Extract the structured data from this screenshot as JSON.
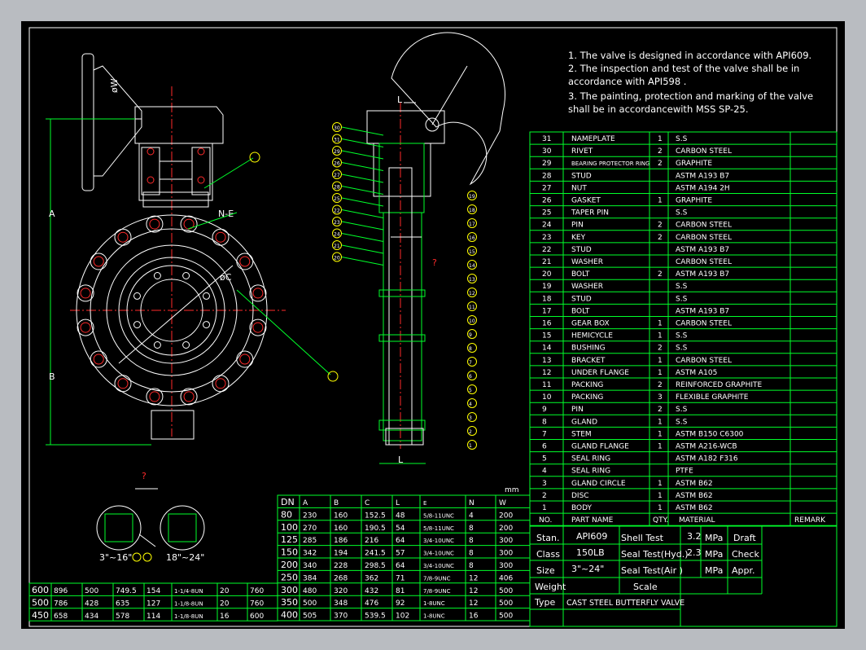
{
  "notes": [
    "1.  The valve is designed in accordance with API609.",
    "2.  The inspection and test of the valve shall be in",
    "     accordance with API598 .",
    "3.  The painting, protection and marking of the valve",
    "     shall be in accordancewith MSS SP-25."
  ],
  "labels": {
    "dim_A": "A",
    "dim_B": "B",
    "dim_L": "L",
    "dim_phiW": "øW",
    "dim_ne": "N-E",
    "dim_phiC": "øC",
    "question_a": "?",
    "question_b": "?",
    "detail_left": "3\"~16\"",
    "detail_right": "18\"~24\"",
    "unit_mm": "mm"
  },
  "parts_table": {
    "rows": [
      [
        "31",
        "NAMEPLATE",
        "1",
        "S.S"
      ],
      [
        "30",
        "RIVET",
        "2",
        "CARBON STEEL"
      ],
      [
        "29",
        "BEARING PROTECTOR RING",
        "2",
        "GRAPHITE"
      ],
      [
        "28",
        "STUD",
        "",
        "ASTM  A193  B7"
      ],
      [
        "27",
        "NUT",
        "",
        "ASTM  A194  2H"
      ],
      [
        "26",
        "GASKET",
        "1",
        "GRAPHITE"
      ],
      [
        "25",
        "TAPER PIN",
        "",
        "S.S"
      ],
      [
        "24",
        "PIN",
        "2",
        "CARBON STEEL"
      ],
      [
        "23",
        "KEY",
        "2",
        "CARBON STEEL"
      ],
      [
        "22",
        "STUD",
        "",
        "ASTM  A193  B7"
      ],
      [
        "21",
        "WASHER",
        "",
        "CARBON STEEL"
      ],
      [
        "20",
        "BOLT",
        "2",
        "ASTM  A193  B7"
      ],
      [
        "19",
        "WASHER",
        "",
        "S.S"
      ],
      [
        "18",
        "STUD",
        "",
        "S.S"
      ],
      [
        "17",
        "BOLT",
        "",
        "ASTM  A193  B7"
      ],
      [
        "16",
        "GEAR BOX",
        "1",
        "CARBON STEEL"
      ],
      [
        "15",
        "HEMICYCLE",
        "1",
        "S.S"
      ],
      [
        "14",
        "BUSHING",
        "2",
        "S.S"
      ],
      [
        "13",
        "BRACKET",
        "1",
        "CARBON STEEL"
      ],
      [
        "12",
        "UNDER FLANGE",
        "1",
        "ASTM   A105"
      ],
      [
        "11",
        "PACKING",
        "2",
        "REINFORCED GRAPHITE"
      ],
      [
        "10",
        "PACKING",
        "3",
        "FLEXIBLE GRAPHITE"
      ],
      [
        "9",
        "PIN",
        "2",
        "S.S"
      ],
      [
        "8",
        "GLAND",
        "1",
        "S.S"
      ],
      [
        "7",
        "STEM",
        "1",
        "ASTM   B150  C6300"
      ],
      [
        "6",
        "GLAND FLANGE",
        "1",
        "ASTM   A216-WCB"
      ],
      [
        "5",
        "SEAL RING",
        "",
        "ASTM   A182  F316"
      ],
      [
        "4",
        "SEAL RING",
        "",
        "PTFE"
      ],
      [
        "3",
        "GLAND CIRCLE",
        "1",
        "ASTM   B62"
      ],
      [
        "2",
        "DISC",
        "1",
        "ASTM   B62"
      ],
      [
        "1",
        "BODY",
        "1",
        "ASTM   B62"
      ]
    ],
    "header": [
      "NO.",
      "PART NAME",
      "QTY.",
      "MATERIAL",
      "REMARK"
    ]
  },
  "title_block": {
    "stan_label": "Stan.",
    "stan_value": "API609",
    "class_label": "Class",
    "class_value": "150LB",
    "size_label": "Size",
    "size_value": "3\"~24\"",
    "weight_label": "Weight",
    "type_label": "Type",
    "type_value": "CAST STEEL BUTTERFLY VALVE",
    "shell_test_label": "Shell Test",
    "shell_test_value": "3.2",
    "seal_hyd_label": "Seal Test(Hyd.)",
    "seal_hyd_value": "2.3",
    "seal_air_label": "Seal Test(Air )",
    "seal_air_value": "",
    "scale_label": "Scale",
    "mpa": "MPa",
    "draft_label": "Draft",
    "check_label": "Check",
    "appr_label": "Appr."
  },
  "dim_table_right": {
    "header": [
      "DN",
      "A",
      "B",
      "C",
      "L",
      "E",
      "N",
      "W"
    ],
    "rows": [
      [
        "80",
        "230",
        "160",
        "152.5",
        "48",
        "5/8-11UNC",
        "4",
        "200"
      ],
      [
        "100",
        "270",
        "160",
        "190.5",
        "54",
        "5/8-11UNC",
        "8",
        "200"
      ],
      [
        "125",
        "285",
        "186",
        "216",
        "64",
        "3/4-10UNC",
        "8",
        "300"
      ],
      [
        "150",
        "342",
        "194",
        "241.5",
        "57",
        "3/4-10UNC",
        "8",
        "300"
      ],
      [
        "200",
        "340",
        "228",
        "298.5",
        "64",
        "3/4-10UNC",
        "8",
        "300"
      ],
      [
        "250",
        "384",
        "268",
        "362",
        "71",
        "7/8-9UNC",
        "12",
        "406"
      ],
      [
        "300",
        "480",
        "320",
        "432",
        "81",
        "7/8-9UNC",
        "12",
        "500"
      ],
      [
        "350",
        "500",
        "348",
        "476",
        "92",
        "1-8UNC",
        "12",
        "500"
      ],
      [
        "400",
        "505",
        "370",
        "539.5",
        "102",
        "1-8UNC",
        "16",
        "500"
      ]
    ]
  },
  "dim_table_left": {
    "rows": [
      [
        "600",
        "896",
        "500",
        "749.5",
        "154",
        "1-1/4-8UN",
        "20",
        "760"
      ],
      [
        "500",
        "786",
        "428",
        "635",
        "127",
        "1-1/8-8UN",
        "20",
        "760"
      ],
      [
        "450",
        "658",
        "434",
        "578",
        "114",
        "1-1/8-8UN",
        "16",
        "600"
      ]
    ]
  },
  "balloons_left": [
    "30",
    "31",
    "29",
    "26",
    "27",
    "28",
    "25",
    "22",
    "23",
    "24",
    "21",
    "20"
  ],
  "balloons_right": [
    "19",
    "18",
    "17",
    "16",
    "15",
    "14",
    "13",
    "12",
    "11",
    "10",
    "9",
    "8",
    "7",
    "6",
    "5",
    "4",
    "3",
    "2",
    "1"
  ]
}
